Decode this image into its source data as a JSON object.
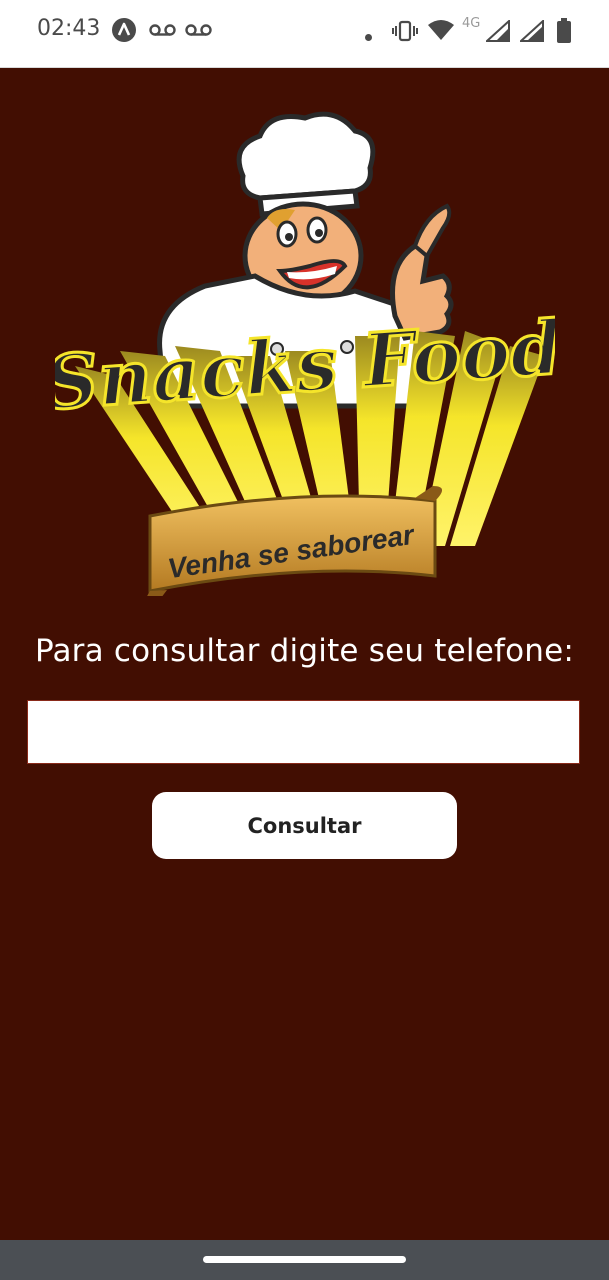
{
  "status_bar": {
    "time": "02:43",
    "network_type": "4G",
    "icons": [
      "app-a-icon",
      "voicemail-icon",
      "voicemail-icon",
      "dot-icon",
      "vibrate-icon",
      "wifi-icon",
      "signal-icon",
      "signal-icon",
      "battery-icon"
    ]
  },
  "logo": {
    "brand_name": "Snacks Food",
    "slogan": "Venha se saborear",
    "mascot": "chef-mascot-thumbs-up"
  },
  "form": {
    "prompt": "Para consultar digite seu telefone:",
    "phone_value": "",
    "phone_placeholder": "",
    "submit_label": "Consultar"
  },
  "colors": {
    "background": "#420E02",
    "status_bar": "#FFFFFF",
    "nav_bar": "#4B4F54",
    "logo_yellow": "#F5E52A",
    "banner_gold": "#D9A035"
  }
}
